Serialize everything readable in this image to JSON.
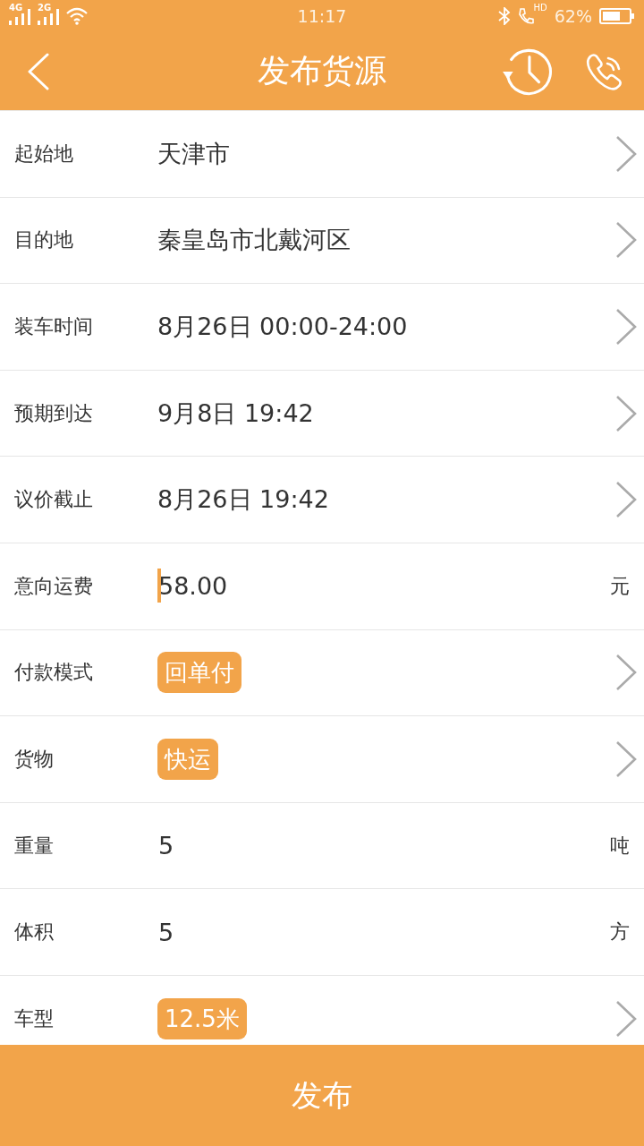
{
  "status_bar": {
    "network_1": "4G",
    "network_2": "2G",
    "time": "11:17",
    "call_badge": "HD",
    "battery": "62%"
  },
  "header": {
    "title": "发布货源"
  },
  "form": {
    "rows": [
      {
        "kind": "select",
        "label": "起始地",
        "value": "天津市"
      },
      {
        "kind": "select",
        "label": "目的地",
        "value": "秦皇岛市北戴河区"
      },
      {
        "kind": "select",
        "label": "装车时间",
        "value": "8月26日 00:00-24:00"
      },
      {
        "kind": "select",
        "label": "预期到达",
        "value": "9月8日 19:42"
      },
      {
        "kind": "select",
        "label": "议价截止",
        "value": "8月26日 19:42"
      },
      {
        "kind": "input",
        "label": "意向运费",
        "value": "58.00",
        "unit": "元",
        "focused": true
      },
      {
        "kind": "tag",
        "label": "付款模式",
        "value": "回单付"
      },
      {
        "kind": "tag",
        "label": "货物",
        "value": "快运"
      },
      {
        "kind": "input",
        "label": "重量",
        "value": "5",
        "unit": "吨",
        "focused": false
      },
      {
        "kind": "input",
        "label": "体积",
        "value": "5",
        "unit": "方",
        "focused": false
      },
      {
        "kind": "tag",
        "label": "车型",
        "value": "12.5米"
      }
    ]
  },
  "submit_button": {
    "label": "发布"
  }
}
